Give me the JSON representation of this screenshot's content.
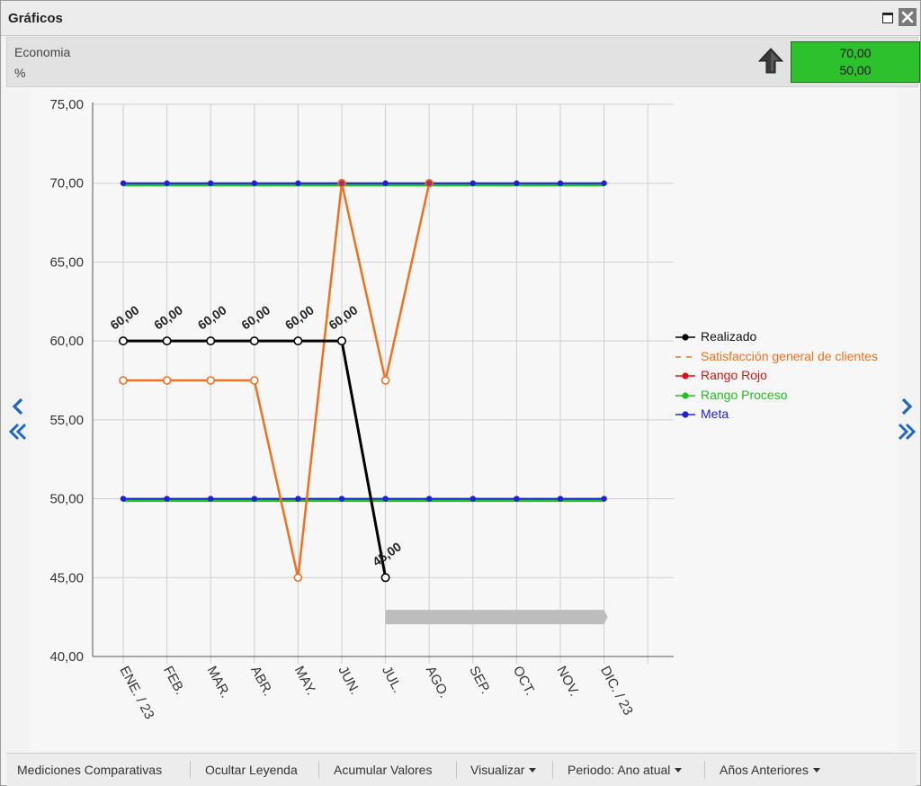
{
  "window": {
    "title": "Gráficos"
  },
  "indicator": {
    "name": "Economia",
    "unit": "%",
    "value_top": "70,00",
    "value_bottom": "50,00",
    "box_color": "#2ec12e"
  },
  "toolbar": {
    "comparative": "Mediciones Comparativas",
    "hide_legend": "Ocultar Leyenda",
    "accumulate": "Acumular Valores",
    "visualize": "Visualizar",
    "period": "Periodo: Ano atual",
    "previous_years": "Años Anteriores"
  },
  "chart_data": {
    "type": "line",
    "ylim": [
      40,
      75
    ],
    "yticks": [
      40,
      45,
      50,
      55,
      60,
      65,
      70,
      75
    ],
    "ytick_labels": [
      "40,00",
      "45,00",
      "50,00",
      "55,00",
      "60,00",
      "65,00",
      "70,00",
      "75,00"
    ],
    "grid": true,
    "legend_position": "right",
    "categories": [
      "ENE. / 23",
      "FEB.",
      "MAR.",
      "ABR.",
      "MAY.",
      "JUN.",
      "JUL.",
      "AGO.",
      "SEP.",
      "OCT.",
      "NOV.",
      "DIC. / 23"
    ],
    "series": [
      {
        "name": "Realizado",
        "color": "#000000",
        "style": "solid-hollow-markers",
        "values": [
          60,
          60,
          60,
          60,
          60,
          60,
          45,
          null,
          null,
          null,
          null,
          null
        ],
        "labels": [
          "60,00",
          "60,00",
          "60,00",
          "60,00",
          "60,00",
          "60,00",
          "45,00"
        ]
      },
      {
        "name": "Satisfacción general de clientes",
        "color": "#f07020",
        "style": "dashed",
        "values": [
          57.5,
          57.5,
          57.5,
          57.5,
          45,
          70,
          57.5,
          70,
          null,
          null,
          null,
          null
        ]
      },
      {
        "name": "Rango Rojo",
        "color": "#e01010",
        "style": "marker",
        "values": [
          null,
          null,
          null,
          null,
          null,
          null,
          null,
          null,
          null,
          null,
          null,
          null
        ]
      },
      {
        "name": "Rango Proceso",
        "color": "#20c020",
        "style": "line",
        "values_upper": [
          70,
          70,
          70,
          70,
          70,
          70,
          70,
          70,
          70,
          70,
          70,
          70
        ],
        "values_lower": [
          50,
          50,
          50,
          50,
          50,
          50,
          50,
          50,
          50,
          50,
          50,
          50
        ]
      },
      {
        "name": "Meta",
        "color": "#2020d0",
        "style": "line",
        "values_upper": [
          70,
          70,
          70,
          70,
          70,
          70,
          70,
          70,
          70,
          70,
          70,
          70
        ],
        "values_lower": [
          50,
          50,
          50,
          50,
          50,
          50,
          50,
          50,
          50,
          50,
          50,
          50
        ]
      }
    ],
    "gray_bar": {
      "from_category": "JUL.",
      "to_category": "DIC. / 23",
      "value": 42.5,
      "color": "#bdbdbd"
    }
  }
}
